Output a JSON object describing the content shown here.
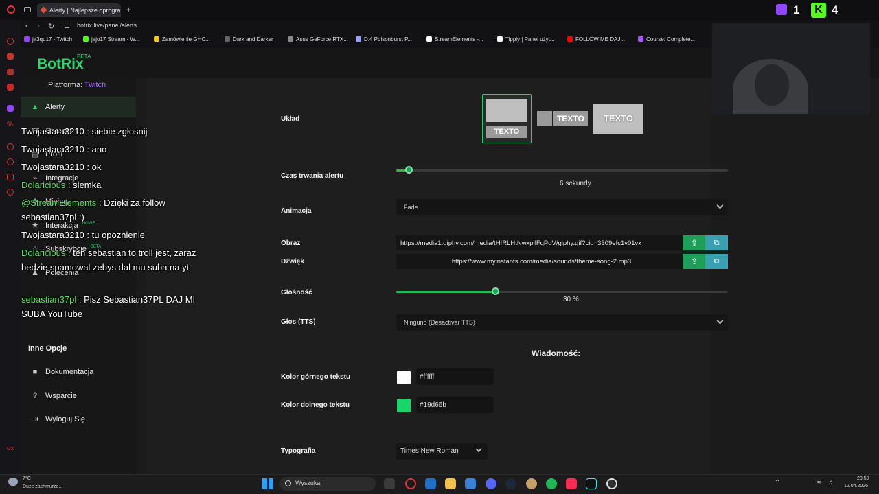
{
  "browser": {
    "tab_title": "Alerty | Najlepsze oprogra",
    "new_tab_symbol": "+",
    "url": "botrix.live/panel/alerts",
    "bookmarks": [
      {
        "label": "ja3qu17 - Twitch",
        "color": "#9147ff"
      },
      {
        "label": "jajo17 Stream - W...",
        "color": "#53fc18"
      },
      {
        "label": "Zamówienie GHC...",
        "color": "#f5c518"
      },
      {
        "label": "Dark and Darker",
        "color": "#666666"
      },
      {
        "label": "Asus GeForce RTX...",
        "color": "#888888"
      },
      {
        "label": "D.4 Poisonburst P...",
        "color": "#9aa0ff"
      },
      {
        "label": "StreamElements -...",
        "color": "#ffffff"
      },
      {
        "label": "Tipply | Panel użyt...",
        "color": "#ffffff"
      },
      {
        "label": "FOLLOW ME DAJ...",
        "color": "#ff0000"
      },
      {
        "label": "Course: Complete...",
        "color": "#a855f7"
      }
    ],
    "twitch_viewers": "1",
    "kick_viewers": "4"
  },
  "app": {
    "logo": "BotRix",
    "logo_badge": "BETA",
    "platform_label": "Platforma:",
    "platform_value": "Twitch",
    "nav": [
      {
        "label": "Alerty",
        "icon": "warning-icon",
        "active": true
      },
      {
        "label": "Chatbot",
        "icon": "chat-icon"
      },
      {
        "label": "Profil",
        "icon": "profile-icon"
      },
      {
        "label": "Integracje",
        "icon": "plug-icon"
      },
      {
        "label": "Minigry",
        "icon": "game-icon"
      },
      {
        "label": "Interakcja",
        "icon": "interaction-icon",
        "badge": "NOWE"
      },
      {
        "label": "Subskrybcje",
        "icon": "star-icon",
        "badge": "BETA"
      },
      {
        "label": "Polecenia",
        "icon": "users-icon"
      }
    ],
    "other_options_title": "Inne Opcje",
    "other_nav": [
      {
        "label": "Dokumentacja",
        "icon": "document-icon"
      },
      {
        "label": "Wsparcie",
        "icon": "help-icon"
      },
      {
        "label": "Wyloguj Się",
        "icon": "logout-icon"
      }
    ]
  },
  "form": {
    "layout_label": "Układ",
    "layout_options": [
      {
        "text": "TEXTO",
        "selected": true
      },
      {
        "text": "TEXTO",
        "selected": false
      },
      {
        "text": "TEXTO",
        "selected": false
      }
    ],
    "duration_label": "Czas trwania alertu",
    "duration_value": "6",
    "duration_unit": "sekundy",
    "duration_fraction": 0.04,
    "animation_label": "Animacja",
    "animation_value": "Fade",
    "image_label": "Obraz",
    "image_url": "https://media1.giphy.com/media/tHIRLHtNwxpjlFqPdV/giphy.gif?cid=3309efc1v01vx",
    "sound_label": "Dźwięk",
    "sound_url": "https://www.myinstants.com/media/sounds/theme-song-2.mp3",
    "volume_label": "Głośność",
    "volume_value": "30",
    "volume_unit": "%",
    "volume_fraction": 0.3,
    "tts_label": "Głos (TTS)",
    "tts_value": "Ninguno (Desactivar TTS)",
    "message_title": "Wiadomość:",
    "top_color_label": "Kolor górnego tekstu",
    "top_color_value": "#ffffff",
    "bottom_color_label": "Kolor dolnego tekstu",
    "bottom_color_value": "#19d66b",
    "typography_label": "Typografia",
    "typography_value": "Times New Roman"
  },
  "chat": [
    {
      "nick": "Twojastara3210",
      "nick_color": "white",
      "text": " : siebie zgłosnij"
    },
    {
      "nick": "Twojastara3210",
      "nick_color": "white",
      "text": " : ano"
    },
    {
      "nick": "Twojastara3210",
      "nick_color": "white",
      "text": " : ok"
    },
    {
      "nick": "Dolaricious",
      "nick_color": "green",
      "text": " : siemka"
    },
    {
      "nick": "@StreamElements",
      "nick_color": "green",
      "text": " : Dzięki za follow sebastian37pl :)"
    },
    {
      "nick": "Twojastara3210",
      "nick_color": "white",
      "text": " : tu opoznienie"
    },
    {
      "nick": "Dolaricious",
      "nick_color": "green",
      "text": " : ten sebastian to troll jest, zaraz bedzie spamowal zebys dal mu suba na yt"
    },
    {
      "nick": "sebastian37pl",
      "nick_color": "green",
      "text": " : Pisz Sebastian37PL DAJ MI SUBA YouTube"
    }
  ],
  "taskbar": {
    "weather_temp": "7°C",
    "weather_desc": "Duże zachmurze...",
    "search_placeholder": "Wyszukaj",
    "time": "20:50",
    "date": "12.04.2026"
  }
}
